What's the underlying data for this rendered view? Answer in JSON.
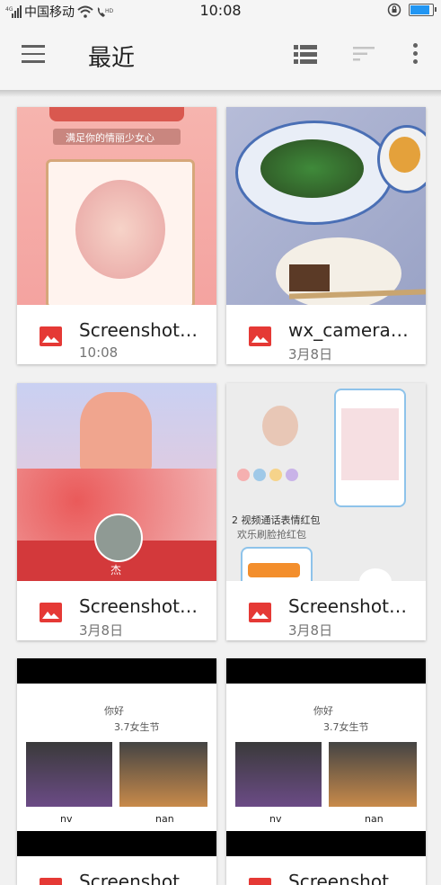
{
  "status_bar": {
    "carrier": "中国移动",
    "time": "10:08",
    "colors": {
      "battery": "#2196f3"
    }
  },
  "toolbar": {
    "title": "最近",
    "icons": [
      "menu-icon",
      "list-view-icon",
      "sort-icon",
      "more-vert-icon"
    ]
  },
  "files": [
    {
      "name": "Screenshot_...",
      "date": "10:08",
      "thumb_caption": "满足你的情丽少女心",
      "icon": "image-icon"
    },
    {
      "name": "wx_camera_...",
      "date": "3月8日",
      "icon": "image-icon"
    },
    {
      "name": "Screenshot_...",
      "date": "3月8日",
      "thumb_caption": "杰",
      "icon": "image-icon"
    },
    {
      "name": "Screenshot_...",
      "date": "3月8日",
      "thumb_caption": "2 视频通话表情红包",
      "thumb_caption2": "欢乐刷脸抢红包",
      "icon": "image-icon"
    },
    {
      "name": "Screenshot_",
      "thumb_caption": "你好",
      "thumb_caption2": "3.7女生节",
      "label_left": "nv",
      "label_right": "nan",
      "icon": "image-icon"
    },
    {
      "name": "Screenshot_",
      "thumb_caption": "你好",
      "thumb_caption2": "3.7女生节",
      "label_left": "nv",
      "label_right": "nan",
      "icon": "image-icon"
    }
  ],
  "colors": {
    "file_icon": "#e53935",
    "accent": "#212121"
  }
}
